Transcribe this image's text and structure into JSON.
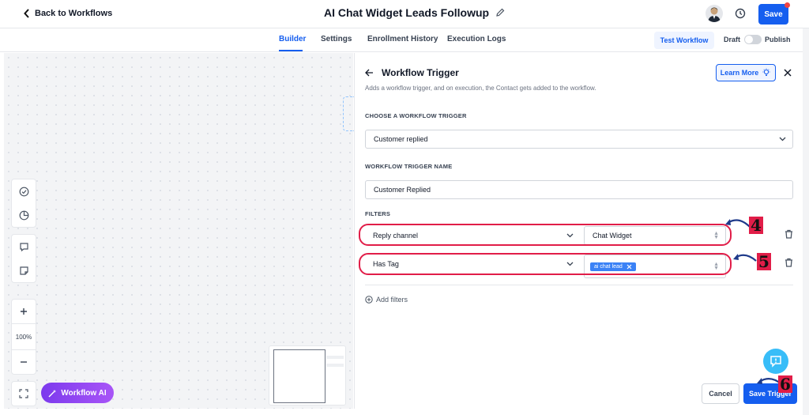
{
  "topbar": {
    "back_label": "Back to Workflows",
    "workflow_title": "AI Chat Widget Leads Followup",
    "save_label": "Save"
  },
  "nav": {
    "tabs": [
      {
        "label": "Builder",
        "active": true
      },
      {
        "label": "Settings"
      },
      {
        "label": "Enrollment History"
      },
      {
        "label": "Execution Logs"
      }
    ],
    "test_workflow_label": "Test Workflow",
    "draft_label": "Draft",
    "publish_label": "Publish",
    "published": false
  },
  "canvas": {
    "zoom_level": "100%",
    "workflow_ai_label": "Workflow AI"
  },
  "panel": {
    "title": "Workflow Trigger",
    "subtitle": "Adds a workflow trigger, and on execution, the Contact gets added to the workflow.",
    "learn_more_label": "Learn More",
    "choose_trigger_label": "CHOOSE A WORKFLOW TRIGGER",
    "trigger_value": "Customer replied",
    "trigger_name_label": "WORKFLOW TRIGGER NAME",
    "trigger_name_value": "Customer Replied",
    "filters_label": "FILTERS",
    "filters": [
      {
        "field": "Reply channel",
        "value": "Chat Widget"
      },
      {
        "field": "Has Tag",
        "tag": "ai chat lead"
      }
    ],
    "add_filters_label": "Add filters",
    "cancel_label": "Cancel",
    "save_trigger_label": "Save Trigger"
  },
  "annotations": {
    "step_4": "4",
    "step_5": "5",
    "step_6": "6"
  },
  "colors": {
    "primary": "#155eef",
    "annotation_red": "#e11d48",
    "ai_purple": "#7c3aed"
  }
}
